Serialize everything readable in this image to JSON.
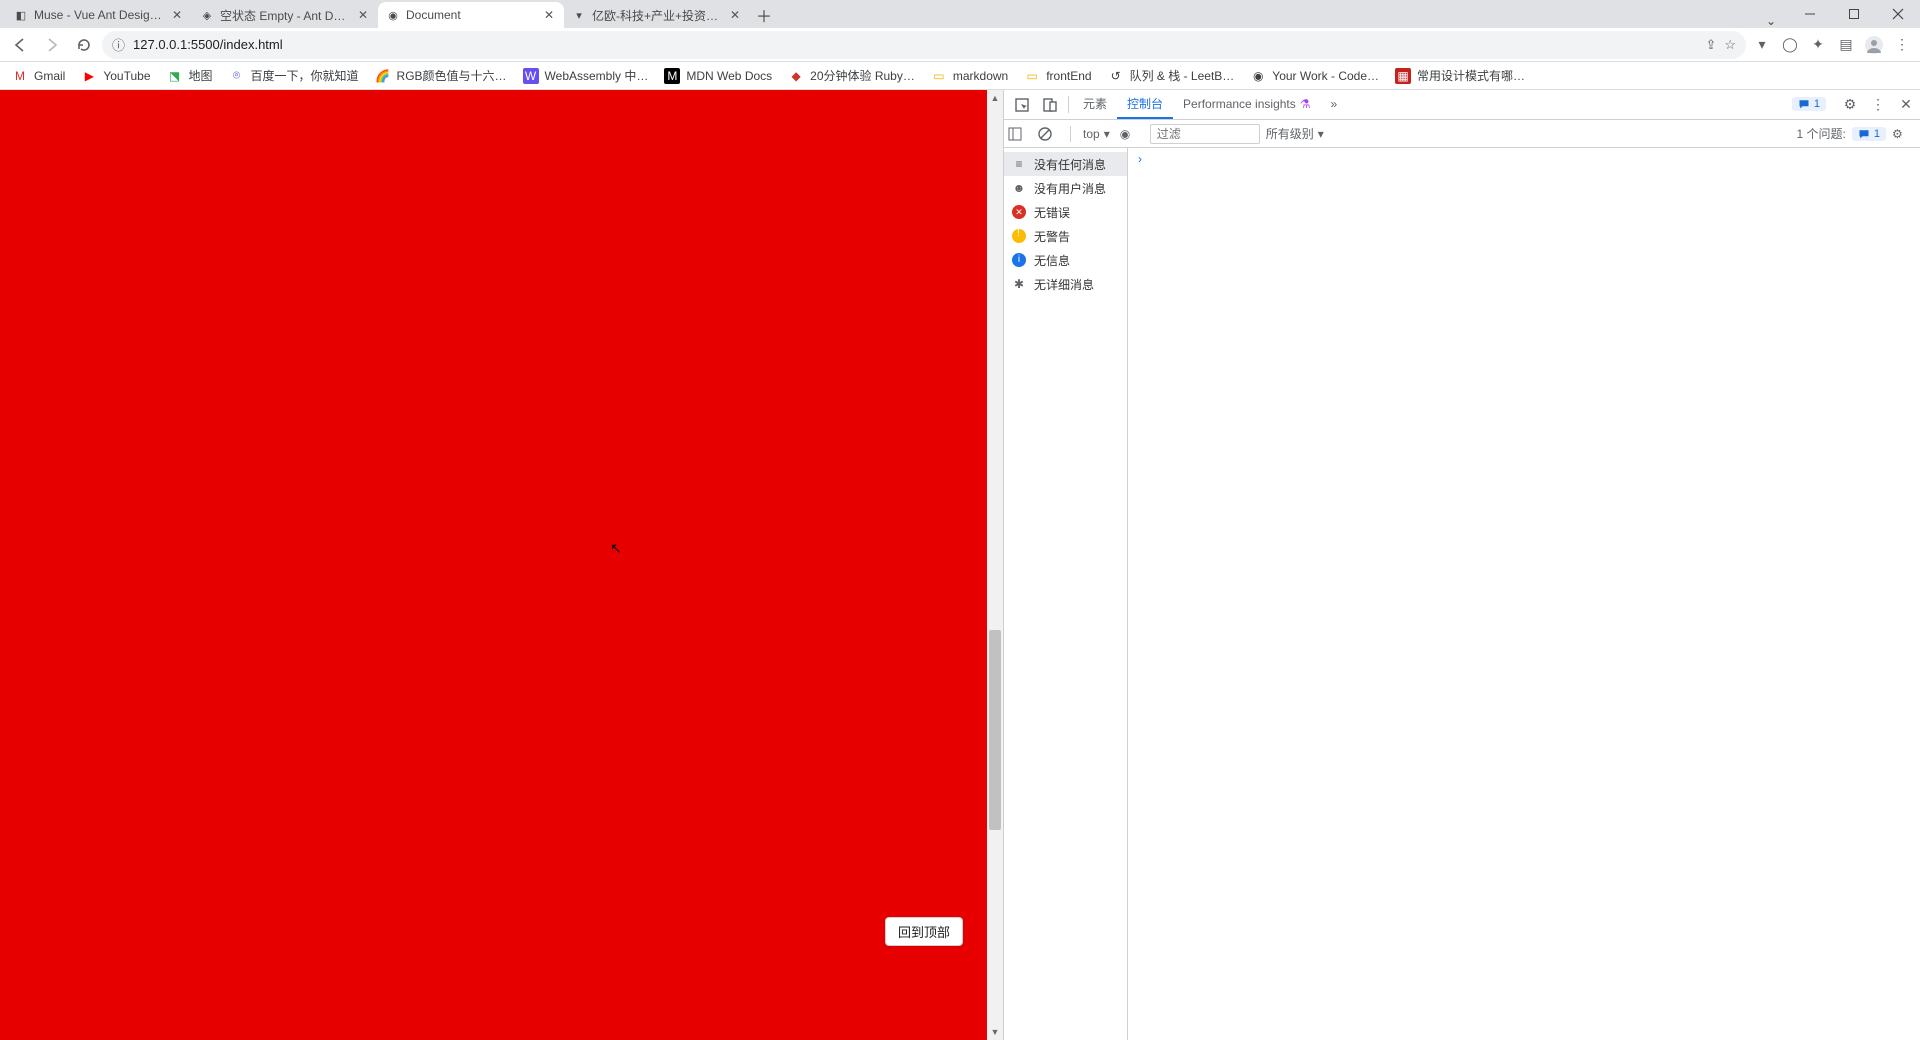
{
  "browser": {
    "tabs": [
      {
        "title": "Muse - Vue Ant Design Dashb",
        "favicon": "◧",
        "active": false
      },
      {
        "title": "空状态 Empty - Ant Design Vu",
        "favicon": "◈",
        "active": false
      },
      {
        "title": "Document",
        "favicon": "◉",
        "active": true
      },
      {
        "title": "亿欧-科技+产业+投资信息平台",
        "favicon": "▾",
        "active": false
      }
    ],
    "url": "127.0.0.1:5500/index.html",
    "bookmarks": [
      {
        "label": "Gmail",
        "icon": "M"
      },
      {
        "label": "YouTube",
        "icon": "▶"
      },
      {
        "label": "地图",
        "icon": "⬔"
      },
      {
        "label": "百度一下，你就知道",
        "icon": "⌾"
      },
      {
        "label": "RGB颜色值与十六…",
        "icon": "🌈"
      },
      {
        "label": "WebAssembly 中…",
        "icon": "W"
      },
      {
        "label": "MDN Web Docs",
        "icon": "M"
      },
      {
        "label": "20分钟体验 Ruby…",
        "icon": "◆"
      },
      {
        "label": "markdown",
        "icon": "▭"
      },
      {
        "label": "frontEnd",
        "icon": "▭"
      },
      {
        "label": "队列 & 栈 - LeetB…",
        "icon": "↺"
      },
      {
        "label": "Your Work - Code…",
        "icon": "◉"
      },
      {
        "label": "常用设计模式有哪…",
        "icon": "▦"
      }
    ]
  },
  "page": {
    "back_to_top": "回到顶部"
  },
  "devtools": {
    "tabs": {
      "elements": "元素",
      "console": "控制台",
      "performance_insights": "Performance insights",
      "more": "»"
    },
    "messages_badge": "1",
    "console_toolbar": {
      "context": "top",
      "filter_placeholder": "过滤",
      "levels": "所有级别",
      "issues_label": "1 个问题:",
      "issues_count": "1"
    },
    "sidebar": [
      {
        "label": "没有任何消息",
        "icon": "list",
        "selected": true
      },
      {
        "label": "没有用户消息",
        "icon": "user"
      },
      {
        "label": "无错误",
        "icon": "error"
      },
      {
        "label": "无警告",
        "icon": "warn"
      },
      {
        "label": "无信息",
        "icon": "info"
      },
      {
        "label": "无详细消息",
        "icon": "bug"
      }
    ],
    "prompt": "›"
  }
}
